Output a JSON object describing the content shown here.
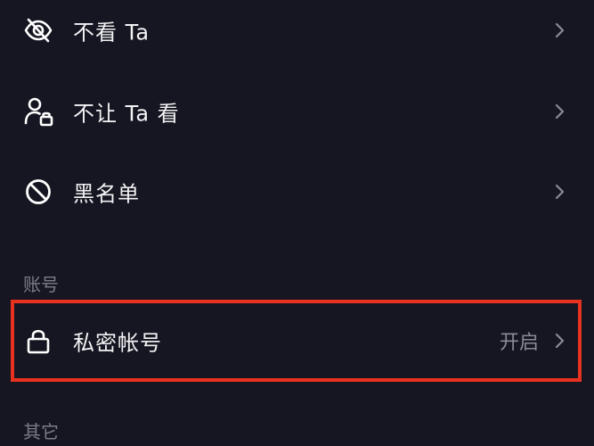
{
  "settings": {
    "items": [
      {
        "label": "不看 Ta",
        "icon": "eye-off-icon"
      },
      {
        "label": "不让 Ta 看",
        "icon": "user-lock-icon"
      },
      {
        "label": "黑名单",
        "icon": "block-icon"
      }
    ]
  },
  "account_section": {
    "header": "账号",
    "private_account": {
      "label": "私密帐号",
      "value": "开启",
      "icon": "lock-icon"
    }
  },
  "other_section": {
    "header": "其它"
  },
  "colors": {
    "background": "#161622",
    "highlight_border": "#e8321f",
    "secondary_text": "#8b8b95"
  }
}
